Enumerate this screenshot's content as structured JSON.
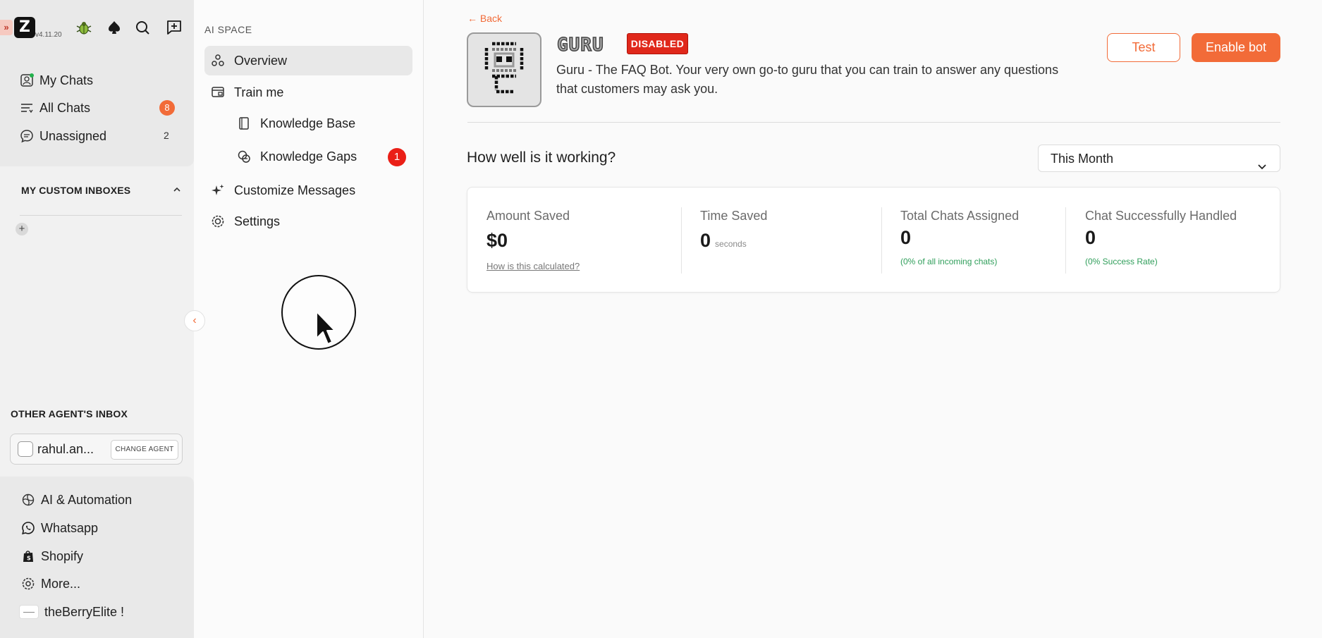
{
  "rail": {
    "version": "v4.11.20",
    "logo_letter": "Z",
    "expand_glyph": "»",
    "nav": [
      {
        "label": "My Chats",
        "icon": "chat-avatar-icon"
      },
      {
        "label": "All Chats",
        "icon": "filter-lines-icon",
        "badge": "8"
      },
      {
        "label": "Unassigned",
        "icon": "chat-bubble-icon",
        "count": "2"
      }
    ],
    "custom_inboxes_title": "MY CUSTOM INBOXES",
    "add_glyph": "+",
    "other_agents_title": "OTHER AGENT'S INBOX",
    "agent_name": "rahul.an...",
    "change_agent_label": "CHANGE AGENT",
    "bottom": [
      {
        "label": "AI & Automation",
        "icon": "ai-swirl-icon"
      },
      {
        "label": "Whatsapp",
        "icon": "whatsapp-icon"
      },
      {
        "label": "Shopify",
        "icon": "shopify-bag-icon"
      },
      {
        "label": "More...",
        "icon": "gear-icon"
      }
    ],
    "brand_name": "theBerryElite !"
  },
  "mid": {
    "title": "AI SPACE",
    "items": [
      {
        "label": "Overview",
        "active": true
      },
      {
        "label": "Train me"
      },
      {
        "label": "Knowledge Base"
      },
      {
        "label": "Knowledge Gaps",
        "badge": "1"
      },
      {
        "label": "Customize Messages"
      },
      {
        "label": "Settings"
      }
    ]
  },
  "main": {
    "back_label": "← Back",
    "bot_logo_text": "GURU",
    "status_badge": "DISABLED",
    "description": "Guru - The FAQ Bot. Your very own go-to guru that you can train to answer any questions that customers may ask you.",
    "test_label": "Test",
    "enable_label": "Enable bot",
    "question": "How well is it working?",
    "period": "This Month",
    "stats": [
      {
        "label": "Amount Saved",
        "value": "$0",
        "link": "How is this calculated?"
      },
      {
        "label": "Time Saved",
        "value": "0",
        "unit": "seconds"
      },
      {
        "label": "Total Chats Assigned",
        "value": "0",
        "note": "(0% of all incoming chats)"
      },
      {
        "label": "Chat Successfully Handled",
        "value": "0",
        "note": "(0% Success Rate)"
      }
    ]
  },
  "colors": {
    "accent": "#f26b38",
    "danger": "#e0281b",
    "success_text": "#2f9e5a"
  }
}
